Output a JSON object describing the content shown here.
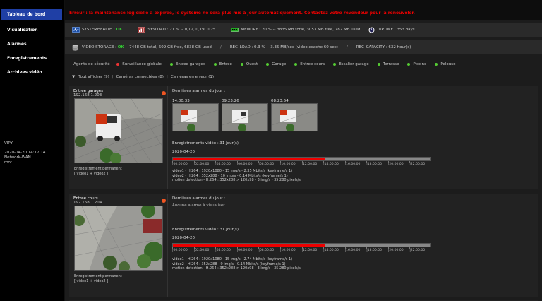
{
  "sidebar": {
    "items": [
      {
        "label": "Tableau de bord",
        "active": true
      },
      {
        "label": "Visualisation"
      },
      {
        "label": "Alarmes"
      },
      {
        "label": "Enregistrements"
      },
      {
        "label": "Archives vidéo"
      }
    ],
    "host": "VIPY",
    "datetime": "2020-04-20  14:17:14",
    "network": "Network-WAN",
    "user": "root"
  },
  "banner": {
    "error": "Erreur : la maintenance logicielle a expirée, le système ne sera plus mis à jour automatiquement. Contactez votre revendeur pour la renouveler."
  },
  "stats": {
    "systemhealth_label": "SYSTEMHEALTH :",
    "systemhealth_value": "OK",
    "sysload_label": "SYSLOAD :",
    "sysload_value": "21 % -- 0,12, 0,19, 0,25",
    "memory_label": "MEMORY :",
    "memory_value": "20 % -- 3835 MB total, 3053 MB free, 782 MB used",
    "uptime_label": "UPTIME :",
    "uptime_value": "353 days"
  },
  "storage": {
    "label": "VIDEO STORAGE :",
    "status": "OK",
    "value": "-- 7448 GB total, 609 GB free, 6838 GB used",
    "sep": "/",
    "rec_load": "REC_LOAD : 0.3 % -- 3.35 MB/sec (video xcache 60 sec)",
    "rec_capacity": "REC_CAPACITY : 632 hour(s)"
  },
  "agents": {
    "label": "Agents de sécurité :",
    "items": [
      {
        "label": "Surveillance globale",
        "color": "#e33"
      },
      {
        "label": "Entree garages",
        "color": "#5c3"
      },
      {
        "label": "Entree",
        "color": "#5c3"
      },
      {
        "label": "Ouest",
        "color": "#5c3"
      },
      {
        "label": "Garage",
        "color": "#5c3"
      },
      {
        "label": "Entree cours",
        "color": "#5c3"
      },
      {
        "label": "Escalier garage",
        "color": "#5c3"
      },
      {
        "label": "Terrasse",
        "color": "#5c3"
      },
      {
        "label": "Piscine",
        "color": "#5c3"
      },
      {
        "label": "Pelouse",
        "color": "#5c3"
      }
    ]
  },
  "filters": {
    "show_all": "Tout afficher (9)",
    "sep": "|",
    "connected": "Caméras connectées (8)",
    "errors": "Caméras en erreur (1)"
  },
  "cameras": [
    {
      "name": "Entree garages",
      "ip": "192.168.1.203",
      "mode": "Enregistrement permanent",
      "streams": "[ video1 + video2 ]",
      "alarms_title": "Dernières alarmes du jour :",
      "alarms": [
        {
          "time": "14:00:33"
        },
        {
          "time": "09:23:26"
        },
        {
          "time": "08:23:54"
        }
      ],
      "no_alarm": "",
      "rec_title": "Enregistrements vidéo : 31 Jour(s)",
      "rec_date": "2020-04-20",
      "rec_progress": 0.59,
      "codecs": [
        "video1 - H.264 : 1920x1080 - 15 img/s - 2.35 Mbits/s (keyframe/s 1)",
        "video2 - H.264 : 352x288 - 10 img/s - 0.14 Mbits/s (keyframe/s 1)",
        "motion detection - H.264 : 352x288 > 120x98 - 3 img/s - 35 280 pixels/s"
      ]
    },
    {
      "name": "Entree cours",
      "ip": "192.168.1.204",
      "mode": "Enregistrement permanent",
      "streams": "[ video1 + video2 ]",
      "alarms_title": "Dernières alarmes du jour :",
      "alarms": [],
      "no_alarm": "Aucune alarme à visualiser.",
      "rec_title": "Enregistrements vidéo : 31 Jour(s)",
      "rec_date": "2020-04-20",
      "rec_progress": 0.59,
      "codecs": [
        "video1 - H.264 : 1920x1080 - 15 img/s - 2.74 Mbits/s (keyframe/s 1)",
        "video2 - H.264 : 352x288 - 9 img/s - 0.14 Mbits/s (keyframe/s 1)",
        "motion detection - H.264 : 352x288 > 120x98 - 3 img/s - 35 280 pixels/s"
      ]
    }
  ],
  "timeline_ticks": [
    "|00:00:00",
    "|02:00:00",
    "|04:00:00",
    "|06:00:00",
    "|08:00:00",
    "|10:00:00",
    "|12:00:00",
    "|14:00:00",
    "|16:00:00",
    "|18:00:00",
    "|20:00:00",
    "|22:00:00"
  ],
  "colors": {
    "accent": "#1f3fa5",
    "error": "#e00",
    "ok": "#33cc33",
    "recorded": "#e00"
  }
}
